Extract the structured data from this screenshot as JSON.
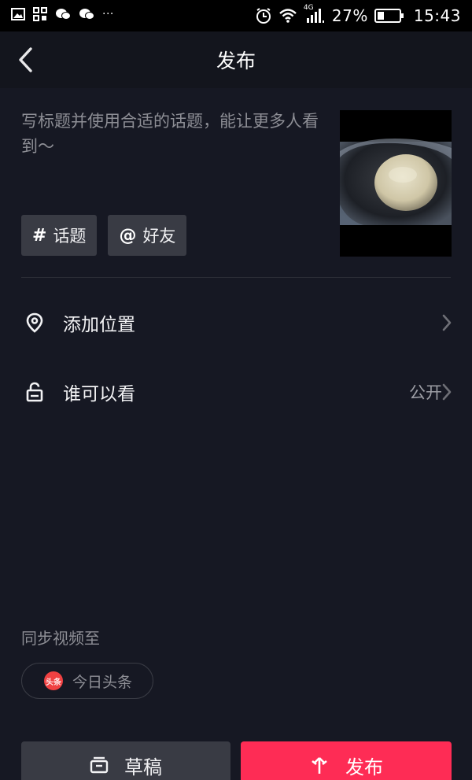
{
  "status_bar": {
    "battery": "27%",
    "time": "15:43",
    "network": "4G",
    "left_icons": [
      "gallery-icon",
      "apps-icon",
      "wechat-icon",
      "wechat-icon",
      "more-dots-icon"
    ],
    "more": "···"
  },
  "header": {
    "title": "发布"
  },
  "caption": {
    "placeholder": "写标题并使用合适的话题，能让更多人看到〜"
  },
  "tags": [
    {
      "symbol": "#",
      "label": "话题"
    },
    {
      "symbol": "@",
      "label": "好友"
    }
  ],
  "rows": [
    {
      "label": "添加位置",
      "value": ""
    },
    {
      "label": "谁可以看",
      "value": "公开"
    }
  ],
  "sync": {
    "label": "同步视频至",
    "chip_label": "今日头条",
    "chip_logo": "头条"
  },
  "buttons": {
    "draft": "草稿",
    "publish": "发布"
  },
  "colors": {
    "background": "#161823",
    "accent": "#fe2c55",
    "secondary_button": "#393b44"
  }
}
